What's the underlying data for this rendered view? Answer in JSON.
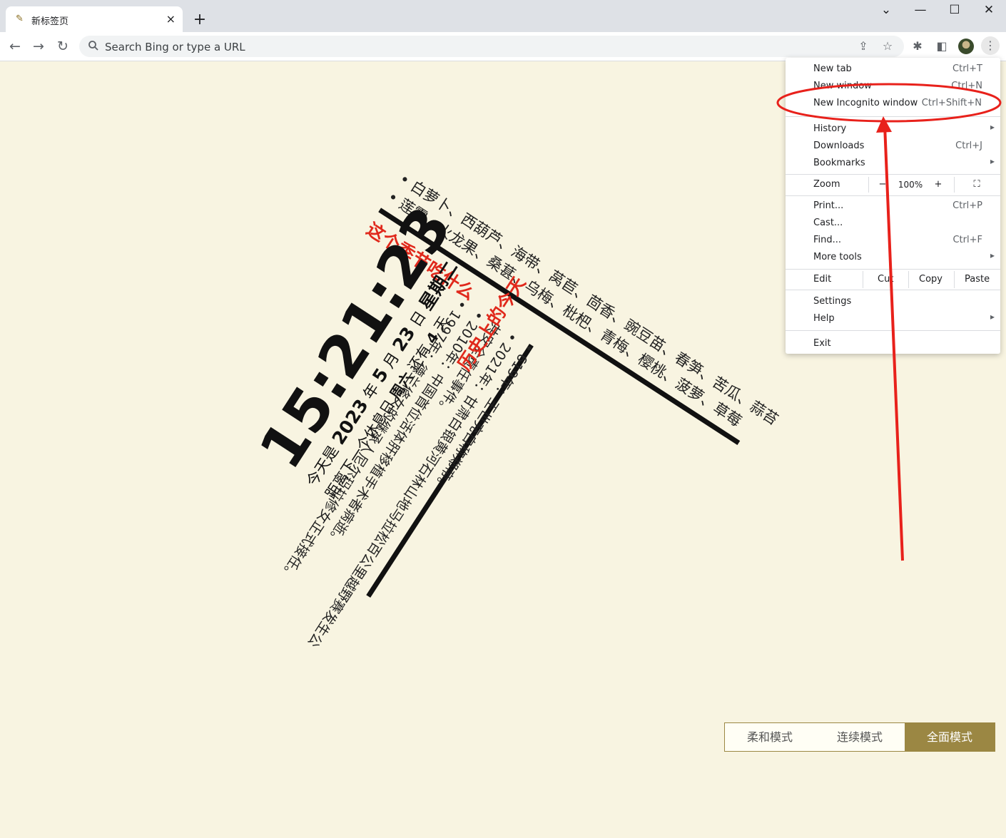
{
  "browser": {
    "tab": {
      "title": "新标签页",
      "close": "×"
    },
    "new_tab": "+",
    "window_controls": {
      "tablist": "⌄",
      "minimize": "—",
      "maximize": "☐",
      "close": "✕"
    },
    "nav": {
      "back": "←",
      "forward": "→",
      "reload": "↻"
    },
    "omnibox_placeholder": "Search Bing or type a URL",
    "icons": [
      "share-icon",
      "star-icon",
      "extensions-icon",
      "sidepanel-icon",
      "avatar",
      "kebab-menu-icon"
    ]
  },
  "newtab": {
    "seasonal_items": [
      "白萝卜、西葫芦、海带、莴苣、茴香、豌豆苗、春笋、苦瓜、蒜苔",
      "莲雾、火龙果、桑葚、乌梅、枇杷、青梅、樱桃、菠萝、草莓"
    ],
    "seasonal_heading": "这个季节吃什么",
    "clock": {
      "time": "15:21:23",
      "date_prefix": "今天是",
      "year": "2023",
      "year_unit": "年",
      "month": "5",
      "month_unit": "月",
      "day": "23",
      "day_unit": "日",
      "weekday": "星期二",
      "countdown_prefix": "距离下一个休息日",
      "countdown_day": "周六",
      "countdown_mid": "还有",
      "countdown_num": "4",
      "countdown_unit": "天"
    },
    "history_heading": "历史上的今天",
    "history_events": [
      "619年：王世充自称郑帝。",
      "1997年：德兰修女的继承人尼尔玛拉修女正式接任。",
      "2010年：中国首位活体肝移植手术者病逝。",
      "2021年：甘肃白银黄河石林山地马拉松百公里越野赛发生公共安全责任事件。"
    ],
    "modes": [
      "柔和模式",
      "连续模式",
      "全面模式"
    ],
    "active_mode": 2
  },
  "menu": {
    "items": {
      "new_tab": {
        "label": "New tab",
        "shortcut": "Ctrl+T"
      },
      "new_window": {
        "label": "New window",
        "shortcut": "Ctrl+N"
      },
      "new_incognito": {
        "label": "New Incognito window",
        "shortcut": "Ctrl+Shift+N"
      },
      "history": {
        "label": "History"
      },
      "downloads": {
        "label": "Downloads",
        "shortcut": "Ctrl+J"
      },
      "bookmarks": {
        "label": "Bookmarks"
      },
      "print": {
        "label": "Print...",
        "shortcut": "Ctrl+P"
      },
      "cast": {
        "label": "Cast..."
      },
      "find": {
        "label": "Find...",
        "shortcut": "Ctrl+F"
      },
      "more_tools": {
        "label": "More tools"
      },
      "settings": {
        "label": "Settings"
      },
      "help": {
        "label": "Help"
      },
      "exit": {
        "label": "Exit"
      }
    },
    "zoom": {
      "label": "Zoom",
      "minus": "−",
      "value": "100%",
      "plus": "+",
      "fullscreen": "⛶"
    },
    "edit": {
      "label": "Edit",
      "cut": "Cut",
      "copy": "Copy",
      "paste": "Paste"
    },
    "submenu_arrow": "▸"
  },
  "colors": {
    "page_bg": "#f8f4e1",
    "accent_red": "#e0281b",
    "mode_gold": "#9b8743",
    "annotation_red": "#e8211b"
  }
}
